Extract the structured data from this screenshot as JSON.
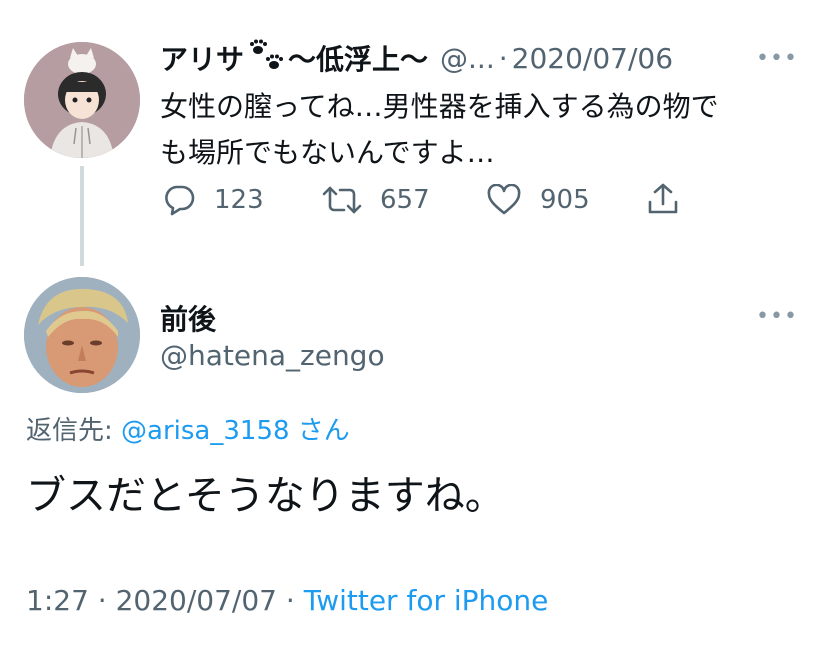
{
  "parent_tweet": {
    "display_name": "アリサ",
    "display_name_suffix": "〜低浮上〜",
    "name_emoji": "paw-prints-icon",
    "handle_truncated": "@...",
    "separator": "·",
    "date": "2020/07/06",
    "text_line1": "女性の膣ってね…男性器を挿入する為の物で",
    "text_line2": "も場所でもないんですよ…",
    "replies": "123",
    "retweets": "657",
    "likes": "905"
  },
  "reply_tweet": {
    "display_name": "前後",
    "handle": "@hatena_zengo",
    "replying_to_label": "返信先:",
    "replying_to_handle": "@arisa_3158",
    "replying_to_suffix": "さん",
    "text": "ブスだとそうなりますね。",
    "time": "1:27",
    "separator1": "·",
    "date": "2020/07/07",
    "separator2": "·",
    "source": "Twitter for iPhone"
  },
  "colors": {
    "text": "#0f1419",
    "muted": "#536471",
    "link": "#1d9bf0",
    "thread_line": "#cfd9de"
  }
}
